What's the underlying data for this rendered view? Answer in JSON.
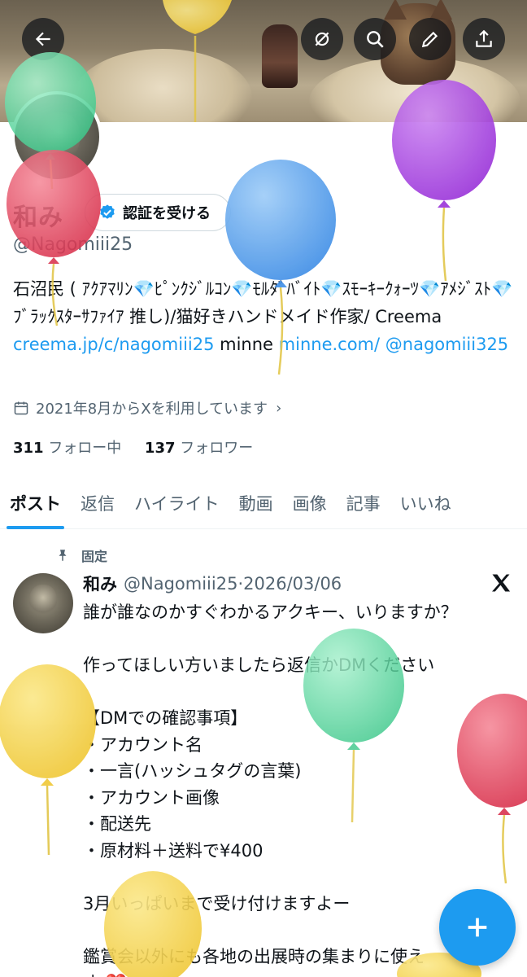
{
  "profile": {
    "name": "和み",
    "verify_label": "認証を受ける",
    "handle": "@Nagomiii25",
    "bio_text": "石沼民 ( ｱｸｱﾏﾘﾝ💎ﾋﾟﾝｸｼﾞﾙｺﾝ💎ﾓﾙﾀﾞﾊﾞｲﾄ💎ｽﾓｰｷｰｸｫｰﾂ💎ｱﾒｼﾞｽﾄ💎ﾌﾞﾗｯｸｽﾀｰｻﾌｧｲｱ 推し)/猫好きハンドメイド作家/ Creema ",
    "bio_link1": "creema.jp/c/nagomiii25",
    "bio_mid": " minne ",
    "bio_link2": "minne.com/ @nagomiii325",
    "joined": "2021年8月からXを利用しています",
    "following_count": "311",
    "following_label": "フォロー中",
    "followers_count": "137",
    "followers_label": "フォロワー"
  },
  "tabs": [
    {
      "label": "ポスト"
    },
    {
      "label": "返信"
    },
    {
      "label": "ハイライト"
    },
    {
      "label": "動画"
    },
    {
      "label": "画像"
    },
    {
      "label": "記事"
    },
    {
      "label": "いいね"
    }
  ],
  "post": {
    "pinned_label": "固定",
    "author": "和み",
    "handle": "@Nagomiii25",
    "separator": "·",
    "date": "2026/03/06",
    "body": "誰が誰なのかすぐわかるアクキー、いりますか？\n\n作ってほしい方いましたら返信かDMください\n\n【DMでの確認事項】\n・アカウント名\n・一言(ハッシュタグの言葉)\n・アカウント画像\n・配送先\n・原材料＋送料で¥400\n\n3月いっぱいまで受け付けますよー\n\n鑑賞会以外にも各地の出展時の集まりに使え\nす ❤️"
  },
  "icons": [
    "back-arrow-icon",
    "no-notifications-icon",
    "search-icon",
    "edit-pencil-icon",
    "share-icon",
    "verified-badge-icon",
    "calendar-icon",
    "chevron-right-icon",
    "pin-icon",
    "x-logo-icon",
    "plus-icon"
  ],
  "colors": {
    "accent": "#1d9bf0",
    "text": "#0f1419",
    "muted": "#536471",
    "balloon_green": "#5fd9a2",
    "balloon_red": "#e8475f",
    "balloon_blue": "#4f9ff0",
    "balloon_purple": "#a73fe0",
    "balloon_yellow": "#f5d44a"
  }
}
